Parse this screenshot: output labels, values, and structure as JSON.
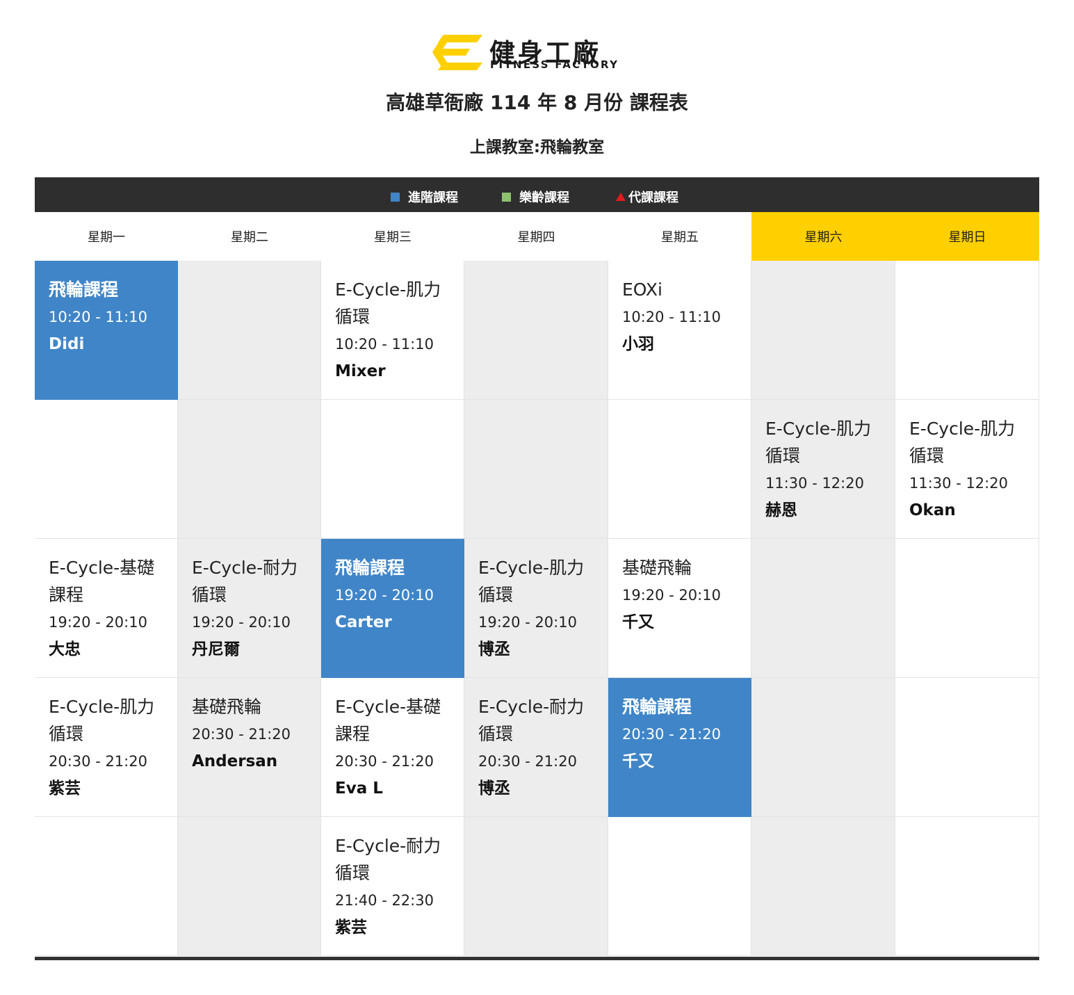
{
  "logo": {
    "name_zh": "健身工廠",
    "name_en": "FITNESS FACTORY",
    "brand_color": "#ffd000"
  },
  "title": "高雄草衙廠 114 年 8 月份 課程表",
  "room": "上課教室:飛輪教室",
  "legend": [
    {
      "label": "進階課程",
      "icon": "blue-square",
      "color": "#3f85c8"
    },
    {
      "label": "樂齡課程",
      "icon": "green-square",
      "color": "#8dc26f"
    },
    {
      "label": "代課課程",
      "icon": "red-triangle",
      "color": "#e21b1b"
    }
  ],
  "days": [
    "星期一",
    "星期二",
    "星期三",
    "星期四",
    "星期五",
    "星期六",
    "星期日"
  ],
  "rows": [
    [
      {
        "name": "飛輪課程",
        "time": "10:20 - 11:10",
        "teacher": "Didi",
        "advanced": true
      },
      null,
      {
        "name": "E-Cycle-肌力循環",
        "time": "10:20 - 11:10",
        "teacher": "Mixer"
      },
      null,
      {
        "name": "EOXi",
        "time": "10:20 - 11:10",
        "teacher": "小羽"
      },
      null,
      null
    ],
    [
      null,
      null,
      null,
      null,
      null,
      {
        "name": "E-Cycle-肌力循環",
        "time": "11:30 - 12:20",
        "teacher": "赫恩"
      },
      {
        "name": "E-Cycle-肌力循環",
        "time": "11:30 - 12:20",
        "teacher": "Okan"
      }
    ],
    [
      {
        "name": "E-Cycle-基礎課程",
        "time": "19:20 - 20:10",
        "teacher": "大忠"
      },
      {
        "name": "E-Cycle-耐力循環",
        "time": "19:20 - 20:10",
        "teacher": "丹尼爾"
      },
      {
        "name": "飛輪課程",
        "time": "19:20 - 20:10",
        "teacher": "Carter",
        "advanced": true
      },
      {
        "name": "E-Cycle-肌力循環",
        "time": "19:20 - 20:10",
        "teacher": "博丞"
      },
      {
        "name": "基礎飛輪",
        "time": "19:20 - 20:10",
        "teacher": "千又"
      },
      null,
      null
    ],
    [
      {
        "name": "E-Cycle-肌力循環",
        "time": "20:30 - 21:20",
        "teacher": "紫芸"
      },
      {
        "name": "基礎飛輪",
        "time": "20:30 - 21:20",
        "teacher": "Andersan"
      },
      {
        "name": "E-Cycle-基礎課程",
        "time": "20:30 - 21:20",
        "teacher": "Eva L"
      },
      {
        "name": "E-Cycle-耐力循環",
        "time": "20:30 - 21:20",
        "teacher": "博丞"
      },
      {
        "name": "飛輪課程",
        "time": "20:30 - 21:20",
        "teacher": "千又",
        "advanced": true
      },
      null,
      null
    ],
    [
      null,
      null,
      {
        "name": "E-Cycle-耐力循環",
        "time": "21:40 - 22:30",
        "teacher": "紫芸"
      },
      null,
      null,
      null,
      null
    ]
  ]
}
